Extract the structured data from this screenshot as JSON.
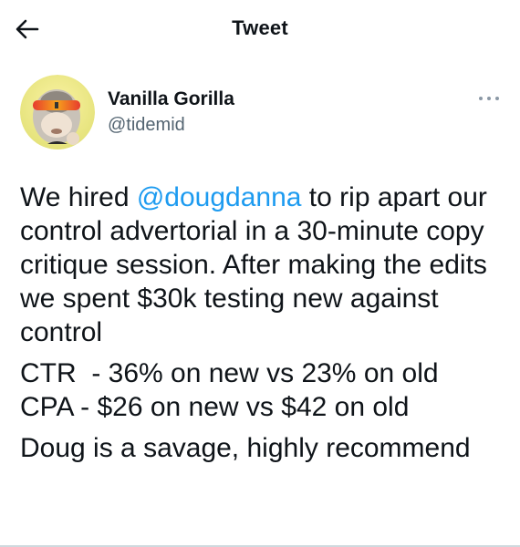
{
  "header": {
    "title": "Tweet",
    "back_icon": "arrow-left-icon"
  },
  "author": {
    "display_name": "Vanilla Gorilla",
    "handle": "@tidemid",
    "avatar_icon": "gorilla-avatar",
    "more_icon": "more-horizontal-icon"
  },
  "tweet": {
    "p1_before": "We hired ",
    "mention": "@dougdanna",
    "p1_after": " to rip apart our control advertorial in a 30-minute copy critique session. After making the edits we spent $30k testing new against control",
    "ctr_line": "CTR  - 36% on new vs 23% on old",
    "cpa_line": "CPA - $26 on new vs $42 on old",
    "closing": "Doug is a savage, highly recommend"
  },
  "colors": {
    "accent": "#1d9bf0",
    "text": "#0f1419",
    "secondary": "#536471"
  }
}
